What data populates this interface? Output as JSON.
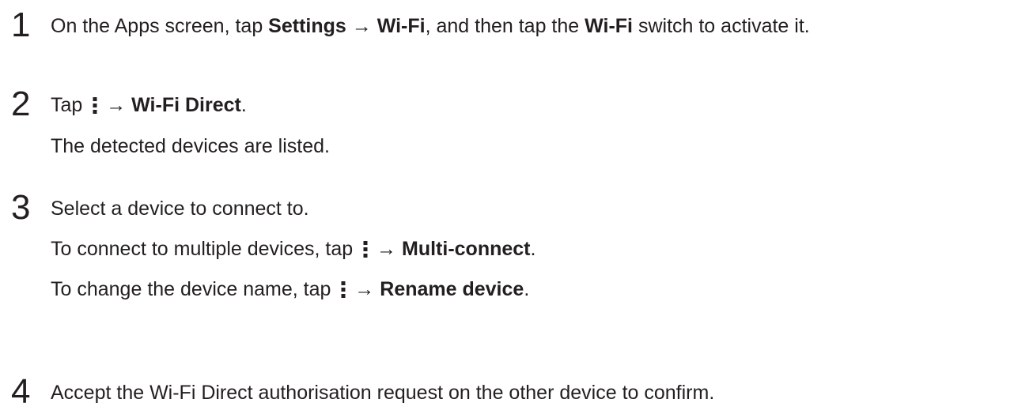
{
  "steps": [
    {
      "number": "1",
      "lines": [
        {
          "parts": [
            {
              "text": "On the Apps screen, tap ",
              "bold": false
            },
            {
              "text": "Settings",
              "bold": true
            },
            {
              "text": " → ",
              "bold": false
            },
            {
              "text": "Wi-Fi",
              "bold": true
            },
            {
              "text": ", and then tap the ",
              "bold": false
            },
            {
              "text": "Wi-Fi",
              "bold": true
            },
            {
              "text": " switch to activate it.",
              "bold": false
            }
          ]
        }
      ]
    },
    {
      "number": "2",
      "lines": [
        {
          "parts": [
            {
              "text": "Tap ",
              "bold": false
            },
            {
              "icon": "more-options-icon"
            },
            {
              "text": " → ",
              "bold": false
            },
            {
              "text": "Wi-Fi Direct",
              "bold": true
            },
            {
              "text": ".",
              "bold": false
            }
          ]
        },
        {
          "parts": [
            {
              "text": "The detected devices are listed.",
              "bold": false
            }
          ]
        }
      ]
    },
    {
      "number": "3",
      "lines": [
        {
          "parts": [
            {
              "text": "Select a device to connect to.",
              "bold": false
            }
          ]
        },
        {
          "parts": [
            {
              "text": "To connect to multiple devices, tap ",
              "bold": false
            },
            {
              "icon": "more-options-icon"
            },
            {
              "text": " → ",
              "bold": false
            },
            {
              "text": "Multi-connect",
              "bold": true
            },
            {
              "text": ".",
              "bold": false
            }
          ]
        },
        {
          "parts": [
            {
              "text": "To change the device name, tap ",
              "bold": false
            },
            {
              "icon": "more-options-icon"
            },
            {
              "text": " → ",
              "bold": false
            },
            {
              "text": "Rename device",
              "bold": true
            },
            {
              "text": ".",
              "bold": false
            }
          ]
        }
      ]
    },
    {
      "number": "4",
      "lines": [
        {
          "parts": [
            {
              "text": "Accept the Wi-Fi Direct authorisation request on the other device to confirm.",
              "bold": false
            }
          ]
        }
      ]
    }
  ],
  "colors": {
    "text": "#231f20",
    "background": "#ffffff"
  }
}
